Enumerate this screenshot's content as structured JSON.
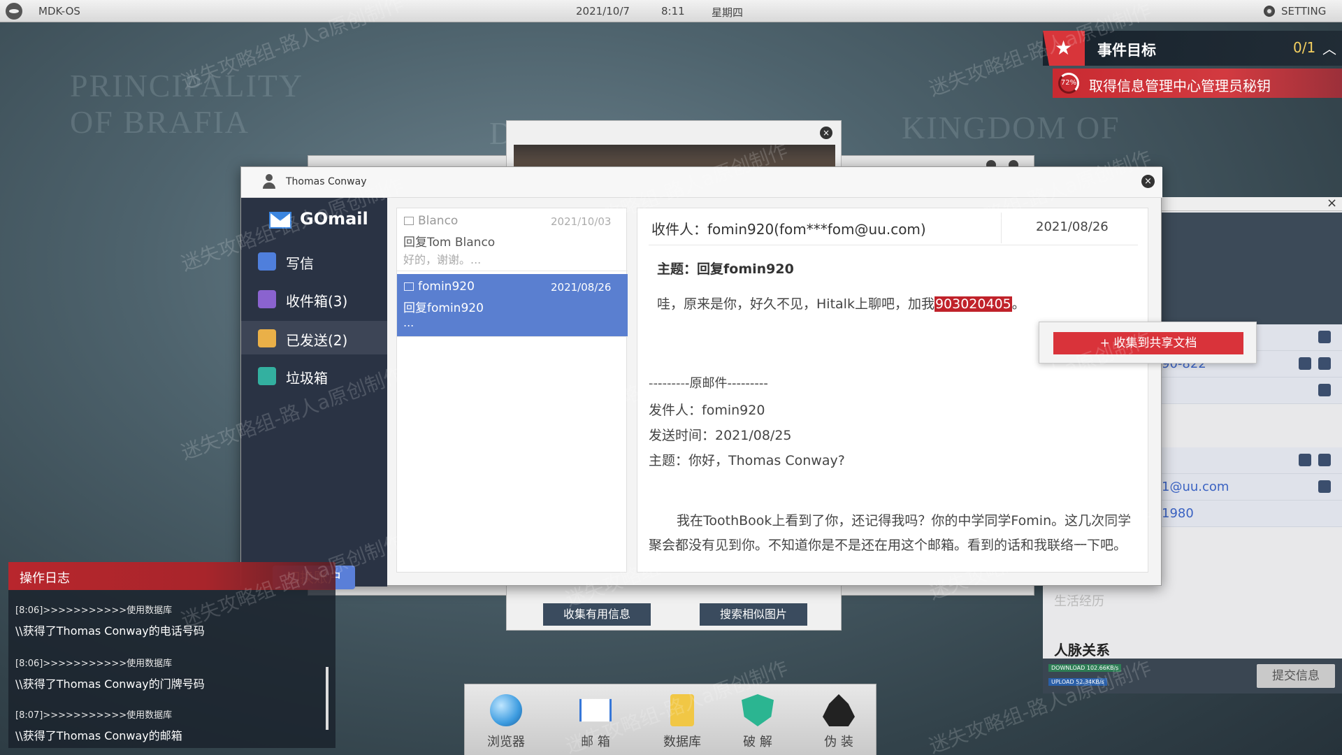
{
  "topbar": {
    "os_name": "MDK-OS",
    "date": "2021/10/7",
    "time": "8:11",
    "weekday": "星期四",
    "setting_label": "SETTING"
  },
  "map": {
    "labels": [
      "PRINCIPALITY",
      "OF BRAFIA",
      "KINGDOM OF",
      "D"
    ]
  },
  "objective": {
    "title": "事件目标",
    "count": "0/1",
    "progress": "72%",
    "task": "取得信息管理中心管理员秘钥"
  },
  "background_window": {
    "collect_button": "收集有用信息",
    "search_button": "搜索相似图片"
  },
  "profile": {
    "phone_partial": "90-822",
    "email_partial": "1@uu.com",
    "year_partial": "1980",
    "life_history": "生活经历",
    "relations": "人脉关系",
    "download_label": "DOWNLOAD",
    "download_speed": "102.66KB/s",
    "upload_label": "UPLOAD",
    "upload_speed": "52.34KB/s",
    "submit_button": "提交信息"
  },
  "gomail": {
    "account_name": "Thomas Conway",
    "app_name": "GOmail",
    "nav": [
      {
        "label": "写信",
        "color": "#4f7fdc"
      },
      {
        "label": "收件箱(3)",
        "color": "#8a63cf"
      },
      {
        "label": "已发送(2)",
        "color": "#eab048"
      },
      {
        "label": "垃圾箱",
        "color": "#33b0a0"
      }
    ],
    "switch_account": "切换账户",
    "mails": [
      {
        "from": "Blanco",
        "date": "2021/10/03",
        "subject": "回复Tom Blanco",
        "preview": "好的，谢谢。..."
      },
      {
        "from": "fomin920",
        "date": "2021/08/26",
        "subject": "回复fomin920",
        "preview": "..."
      }
    ],
    "reader": {
      "to": "收件人：fomin920(fom***fom@uu.com)",
      "date": "2021/08/26",
      "subject": "主题：回复fomin920",
      "body_before": "哇，原来是你，好久不见，Hitalk上聊吧，加我",
      "phone": "903020405",
      "body_after": "。",
      "original_header": "---------原邮件---------",
      "orig_from": "发件人：fomin920",
      "orig_time": "发送时间：2021/08/25",
      "orig_subject": "主题：你好，Thomas Conway?",
      "orig_body": "我在ToothBook上看到了你，还记得我吗？你的中学同学Fomin。这几次同学聚会都没有见到你。不知道你是不是还在用这个邮箱。看到的话和我联络一下吧。"
    }
  },
  "context_popup": {
    "button": "+ 收集到共享文档"
  },
  "oplog": {
    "title": "操作日志",
    "entries": [
      {
        "time": "[8:06]>>>>>>>>>>>使用数据库",
        "msg": "\\\\获得了Thomas Conway的电话号码"
      },
      {
        "time": "[8:06]>>>>>>>>>>>使用数据库",
        "msg": "\\\\获得了Thomas Conway的门牌号码"
      },
      {
        "time": "[8:07]>>>>>>>>>>>使用数据库",
        "msg": "\\\\获得了Thomas Conway的邮箱"
      }
    ]
  },
  "dock": {
    "items": [
      {
        "label": "浏览器",
        "icon": "globe-icon"
      },
      {
        "label": "邮 箱",
        "icon": "mail-icon"
      },
      {
        "label": "数据库",
        "icon": "database-icon"
      },
      {
        "label": "破 解",
        "icon": "crack-shield-icon"
      },
      {
        "label": "伪 装",
        "icon": "disguise-hat-icon"
      }
    ]
  },
  "watermark": "迷失攻略组-路人a原创制作"
}
